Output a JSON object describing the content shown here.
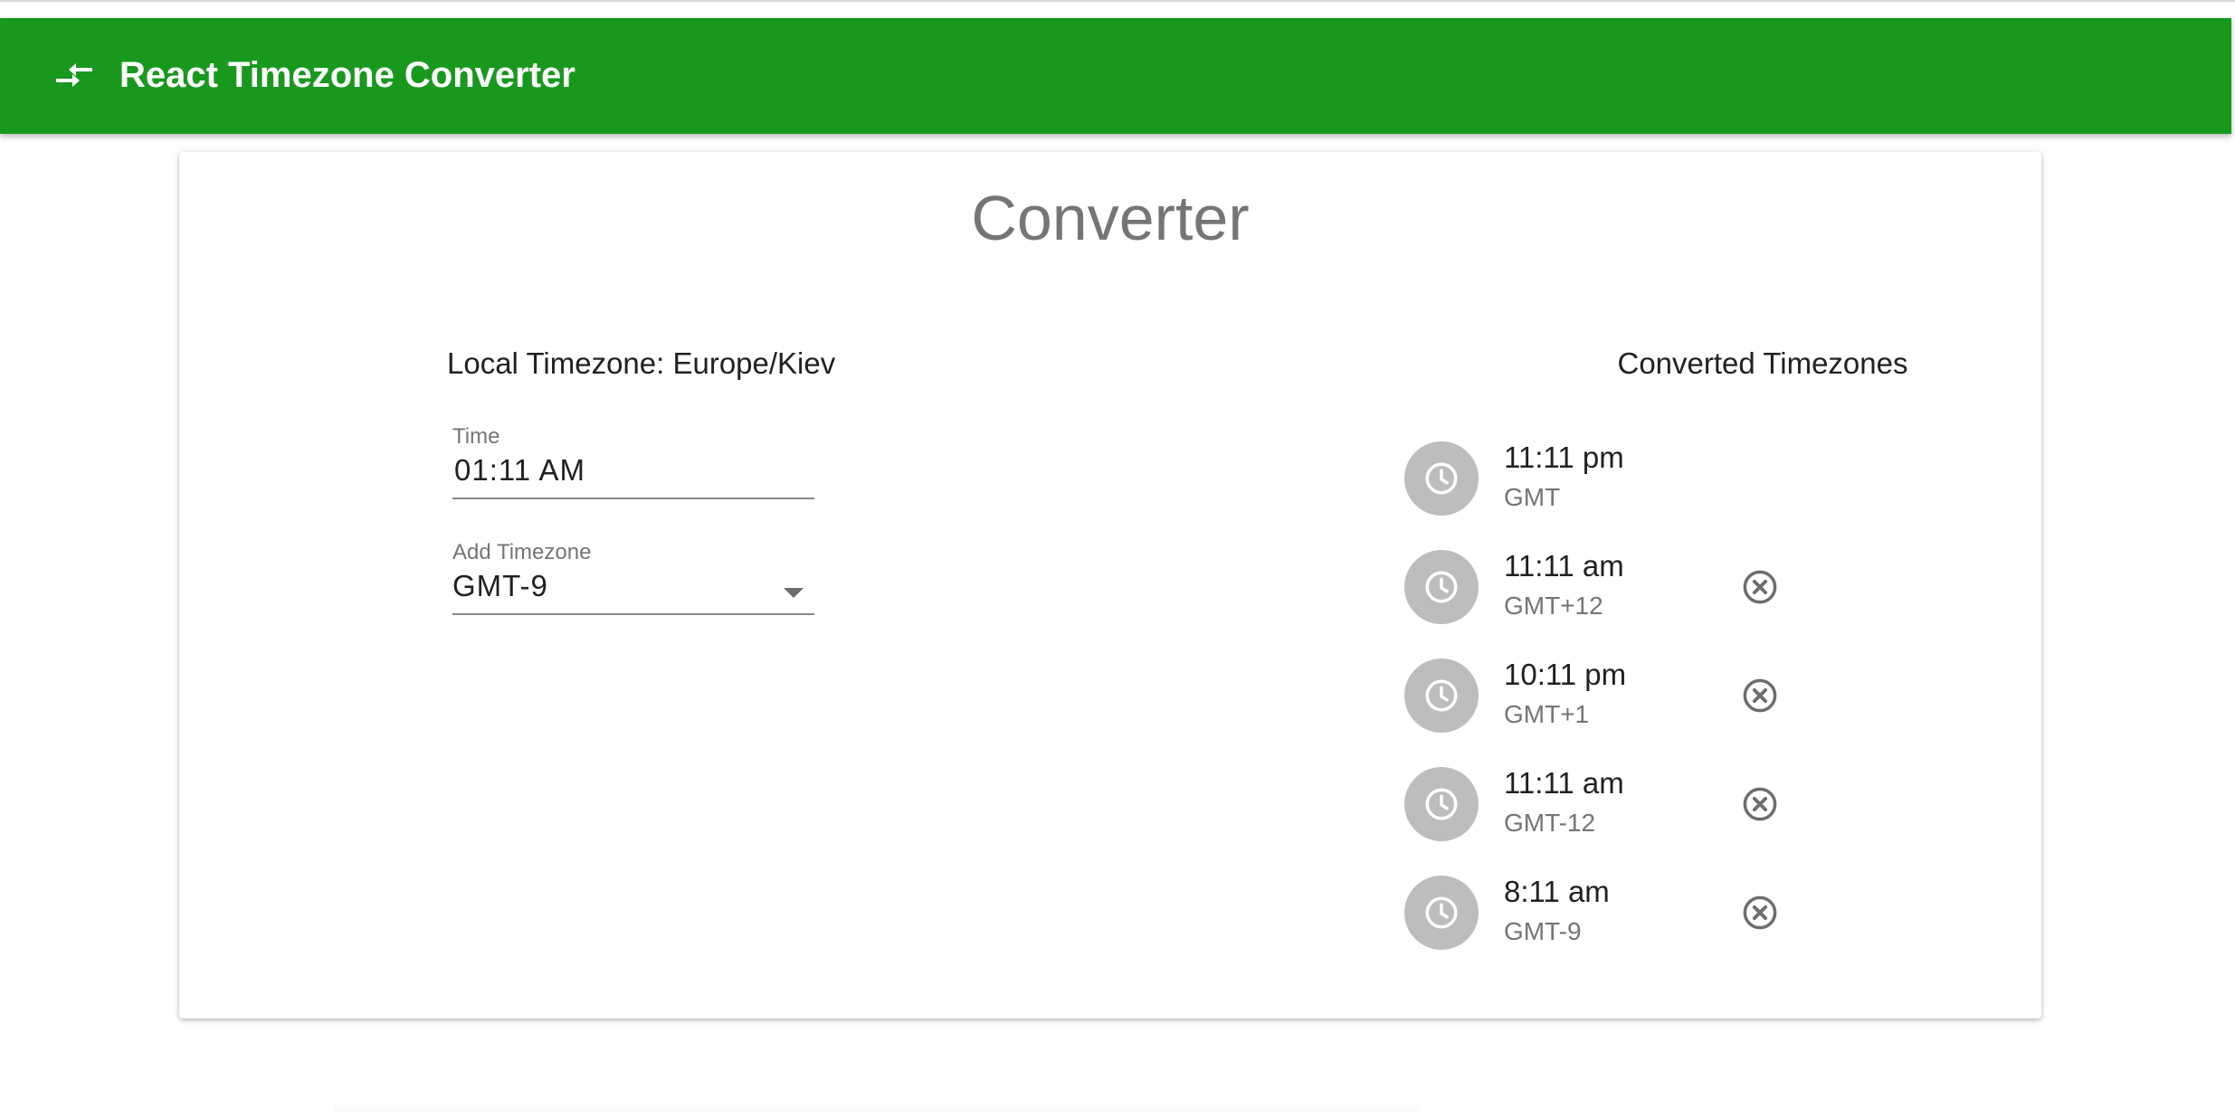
{
  "app": {
    "title": "React Timezone Converter",
    "icon": "compare-arrows-icon",
    "brand_color": "#18991e"
  },
  "card": {
    "title": "Converter"
  },
  "local": {
    "label": "Local Timezone: Europe/Kiev",
    "time_field": {
      "label": "Time",
      "value": "01:11 AM"
    },
    "timezone_select": {
      "label": "Add Timezone",
      "value": "GMT-9"
    }
  },
  "converted": {
    "title": "Converted Timezones",
    "items": [
      {
        "time": "11:11 pm",
        "zone": "GMT",
        "removable": false
      },
      {
        "time": "11:11 am",
        "zone": "GMT+12",
        "removable": true
      },
      {
        "time": "10:11 pm",
        "zone": "GMT+1",
        "removable": true
      },
      {
        "time": "11:11 am",
        "zone": "GMT-12",
        "removable": true
      },
      {
        "time": "8:11 am",
        "zone": "GMT-9",
        "removable": true
      }
    ]
  }
}
